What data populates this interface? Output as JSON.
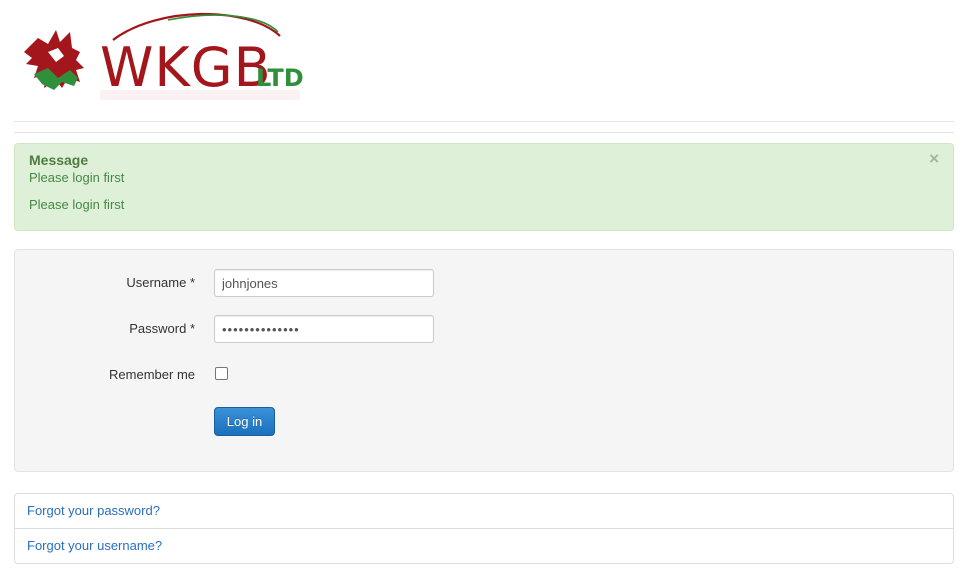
{
  "logo": {
    "letters": "WKGB",
    "suffix": "LTD",
    "icon": "welsh-dragon-icon",
    "colors": {
      "red": "#a3161c",
      "green": "#2f8f3a"
    }
  },
  "alert": {
    "heading": "Message",
    "messages": [
      "Please login first",
      "Please login first"
    ],
    "close_glyph": "×",
    "colors": {
      "background": "#dff0d8",
      "text": "#468847"
    }
  },
  "login_form": {
    "username_label": "Username *",
    "username_value": "johnjones",
    "password_label": "Password *",
    "password_value": "••••••••••••••",
    "remember_label": "Remember me",
    "remember_checked": false,
    "submit_label": "Log in"
  },
  "links": {
    "forgot_password": "Forgot your password?",
    "forgot_username": "Forgot your username?"
  },
  "colors": {
    "primary_button": "#2a7fcb",
    "link": "#2a6ebf"
  }
}
